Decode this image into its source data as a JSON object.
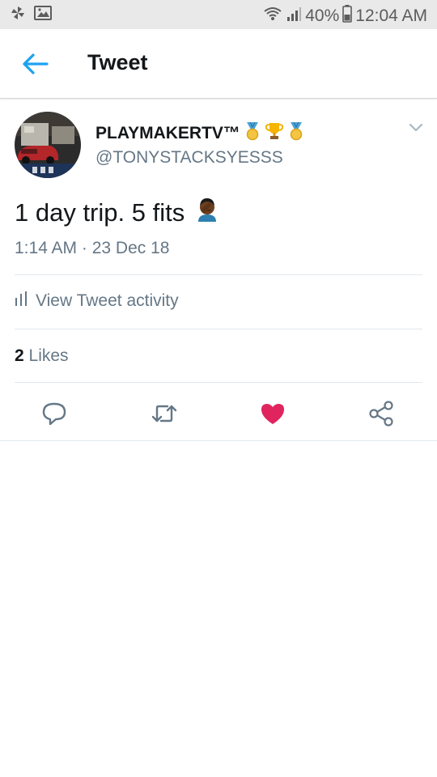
{
  "status_bar": {
    "battery": "40%",
    "time": "12:04 AM"
  },
  "app_bar": {
    "title": "Tweet"
  },
  "tweet": {
    "display_name": "PLAYMAKERTV™",
    "handle": "@TONYSTACKSYESSS",
    "text": "1 day trip. 5 fits",
    "timestamp": "1:14 AM · 23 Dec 18",
    "activity_label": "View Tweet activity",
    "likes_count": "2",
    "likes_label": "Likes"
  },
  "colors": {
    "accent": "#1da1f2",
    "like": "#e0245e",
    "secondary_text": "#657786"
  },
  "icons": {
    "name_badges": [
      "medal-icon",
      "trophy-icon",
      "medal-icon"
    ],
    "actions": [
      "reply-icon",
      "retweet-icon",
      "heart-icon",
      "share-icon"
    ]
  }
}
